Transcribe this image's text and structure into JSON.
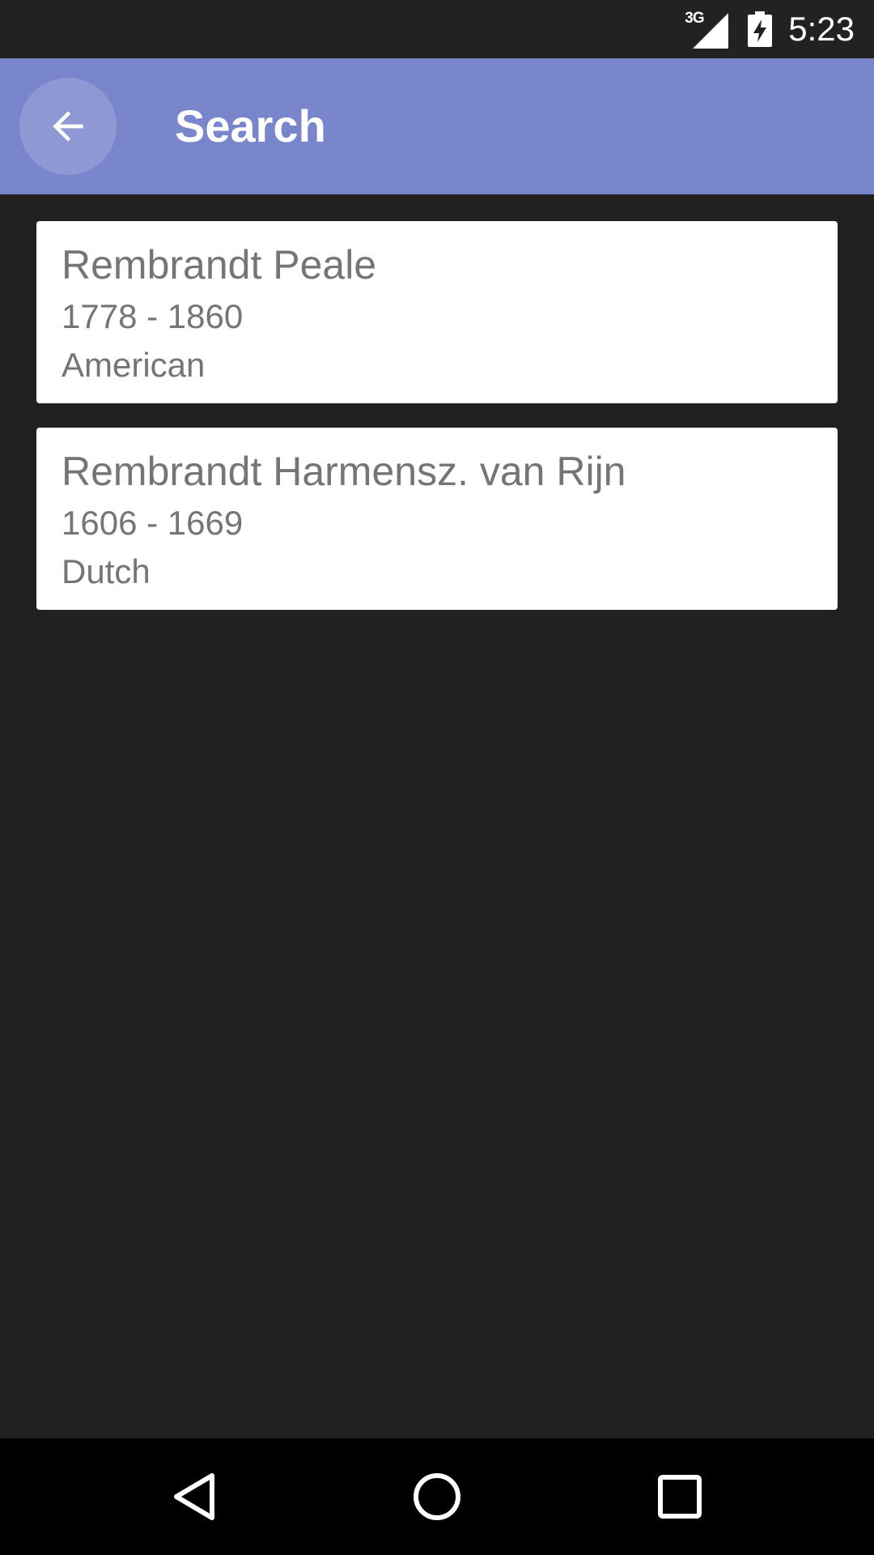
{
  "status_bar": {
    "network": "3G",
    "time": "5:23",
    "icons": [
      "signal-icon",
      "battery-charging-icon"
    ]
  },
  "app_bar": {
    "title": "Search",
    "back_icon": "arrow-back-icon",
    "color": "#7986cb"
  },
  "results": [
    {
      "name": "Rembrandt Peale",
      "years": "1778 - 1860",
      "nationality": "American"
    },
    {
      "name": "Rembrandt Harmensz. van Rijn",
      "years": "1606 - 1669",
      "nationality": "Dutch"
    }
  ],
  "nav_bar": {
    "icons": [
      "nav-back-icon",
      "nav-home-icon",
      "nav-recents-icon"
    ]
  },
  "colors": {
    "background": "#212121",
    "card_background": "#ffffff",
    "card_text": "#757575",
    "nav_bar": "#000000"
  }
}
